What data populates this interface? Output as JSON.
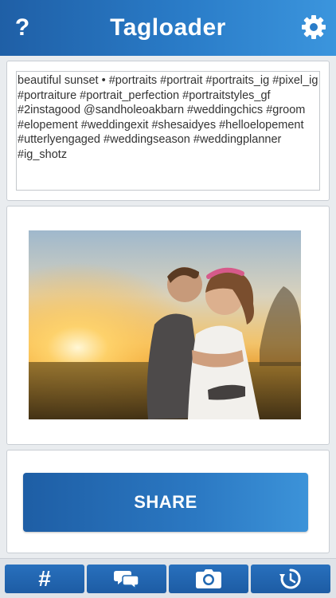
{
  "header": {
    "title": "Tagloader",
    "help_label": "?",
    "settings_icon": "gear-icon",
    "gradient": [
      "#1f5fa6",
      "#3b95dd"
    ]
  },
  "tags": {
    "text": "beautiful sunset • #portraits #portrait #portraits_ig #pixel_ig #portraiture #portrait_perfection #portraitstyles_gf #2instagood @sandholeoakbarn #weddingchics #groom #elopement #weddingexit #shesaidyes #helloelopement #utterlyengaged #weddingseason #weddingplanner #ig_shotz"
  },
  "photo": {
    "subject": "couple-embracing-at-sunset"
  },
  "share": {
    "label": "SHARE",
    "color": "#2b78c2"
  },
  "tabbar": {
    "tabs": [
      {
        "id": "hashtags",
        "label": "#",
        "icon": "hashtag-icon"
      },
      {
        "id": "chat",
        "label": "",
        "icon": "chat-bubbles-icon"
      },
      {
        "id": "camera",
        "label": "",
        "icon": "camera-icon"
      },
      {
        "id": "history",
        "label": "",
        "icon": "history-icon"
      }
    ]
  }
}
